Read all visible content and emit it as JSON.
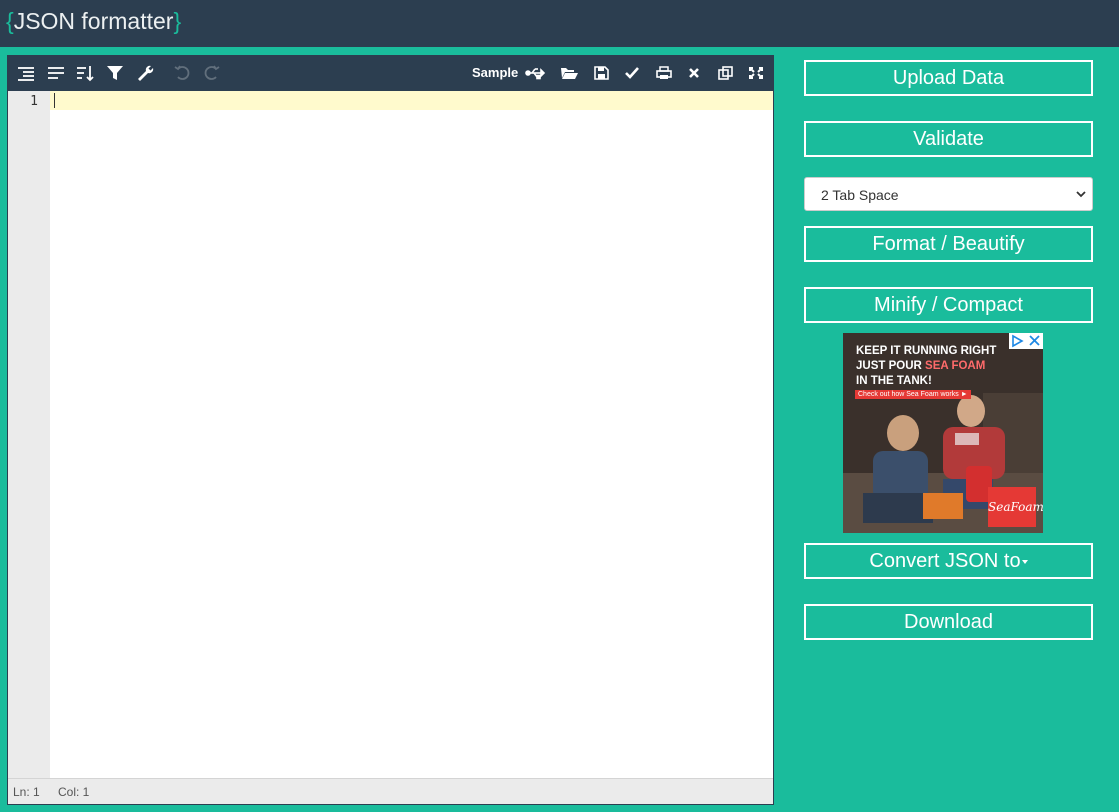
{
  "app": {
    "brace_open": "{",
    "title": "JSON formatter",
    "brace_close": "}"
  },
  "toolbar": {
    "icons": [
      "format-icon",
      "compact-icon",
      "sort-icon",
      "filter-icon",
      "wrench-icon",
      "undo-icon",
      "redo-icon",
      "usb-icon",
      "folder-open-icon",
      "save-icon",
      "check-icon",
      "print-icon",
      "clear-icon",
      "copy-icon",
      "fullscreen-icon"
    ],
    "sample_label": "Sample"
  },
  "editor": {
    "line_numbers": [
      "1"
    ],
    "content": ""
  },
  "status": {
    "line": "Ln: 1",
    "col": "Col: 1"
  },
  "sidebar": {
    "upload": "Upload Data",
    "validate": "Validate",
    "indent_selected": "2 Tab Space",
    "format": "Format / Beautify",
    "minify": "Minify / Compact",
    "convert": "Convert JSON to",
    "download": "Download"
  },
  "ad": {
    "line1": "KEEP IT RUNNING RIGHT",
    "line2_a": "JUST POUR",
    "line2_b": "SEA FOAM",
    "line3": "IN THE TANK!",
    "cta": "Check out how Sea Foam works ►",
    "logo": "SeaFoam"
  },
  "colors": {
    "header": "#2c3e50",
    "accent": "#1abc9c",
    "active_line": "#fffacd"
  }
}
